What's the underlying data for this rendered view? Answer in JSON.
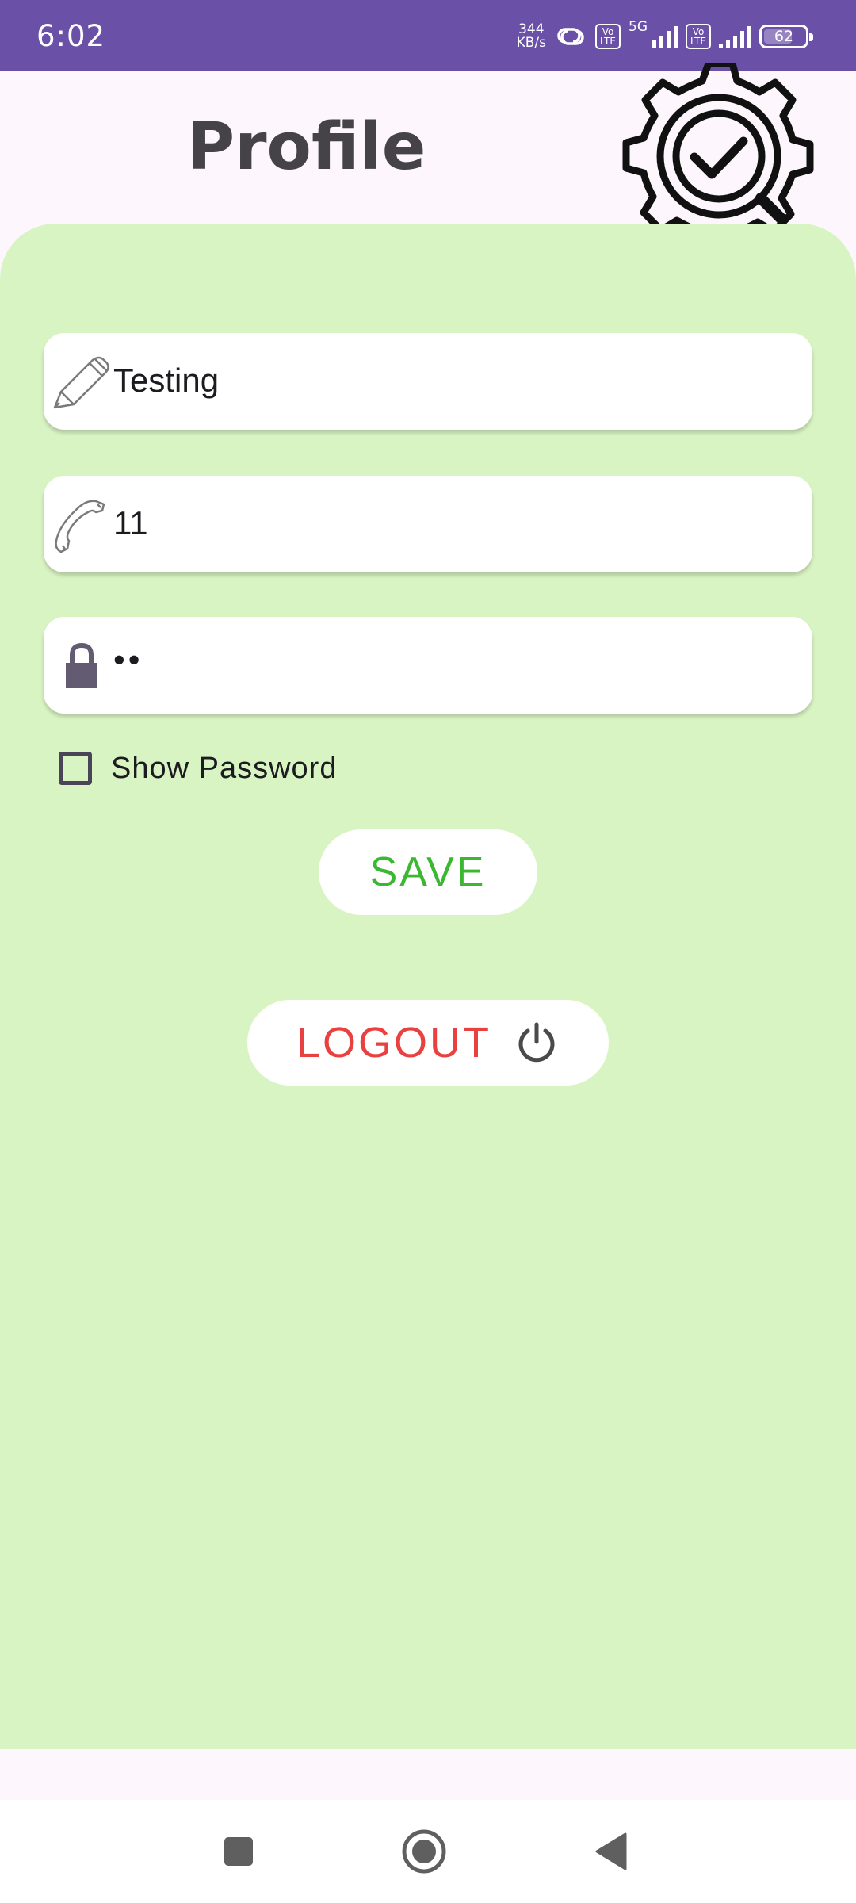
{
  "status_bar": {
    "time": "6:02",
    "net_speed_value": "344",
    "net_speed_unit": "KB/s",
    "volte_1": "Vo LTE",
    "volte_2": "Vo LTE",
    "network_type": "5G",
    "battery_level": "62",
    "background_color": "#6a50a7"
  },
  "header": {
    "title": "Profile",
    "logo_icon": "gear-check-magnifier-icon"
  },
  "form": {
    "name_value": "Testing",
    "name_icon": "pencil-icon",
    "phone_value": "11",
    "phone_icon": "phone-icon",
    "password_value": "••",
    "password_icon": "lock-icon",
    "show_password_label": "Show Password",
    "show_password_checked": false
  },
  "actions": {
    "save_label": "SAVE",
    "logout_label": "LOGOUT",
    "logout_icon": "power-icon"
  },
  "colors": {
    "card_background": "#d9f4c3",
    "save_text": "#3cb731",
    "logout_text": "#e8413f",
    "page_background": "#fdf6fd"
  },
  "nav_bar": {
    "recents_icon": "square-recents-icon",
    "home_icon": "circle-home-icon",
    "back_icon": "triangle-back-icon"
  }
}
